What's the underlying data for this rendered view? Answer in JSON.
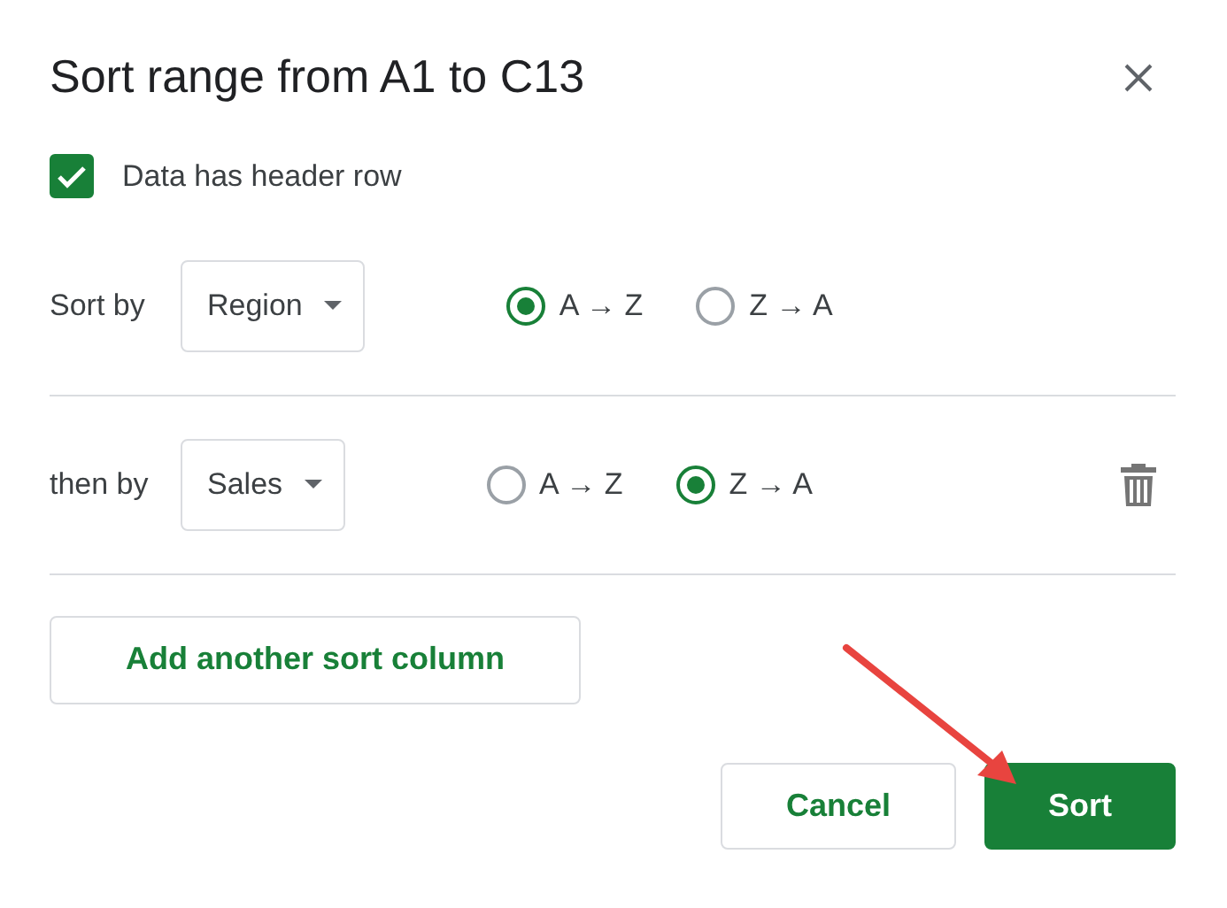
{
  "dialog": {
    "title": "Sort range from A1 to C13"
  },
  "header_row": {
    "label": "Data has header row",
    "checked": true
  },
  "sort_rules": [
    {
      "label": "Sort by",
      "column": "Region",
      "deletable": false,
      "options": [
        {
          "label": "A → Z",
          "selected": true
        },
        {
          "label": "Z → A",
          "selected": false
        }
      ]
    },
    {
      "label": "then by",
      "column": "Sales",
      "deletable": true,
      "options": [
        {
          "label": "A → Z",
          "selected": false
        },
        {
          "label": "Z → A",
          "selected": true
        }
      ]
    }
  ],
  "add_button": "Add another sort column",
  "buttons": [
    {
      "label": "Cancel",
      "kind": "secondary"
    },
    {
      "label": "Sort",
      "kind": "primary"
    }
  ]
}
